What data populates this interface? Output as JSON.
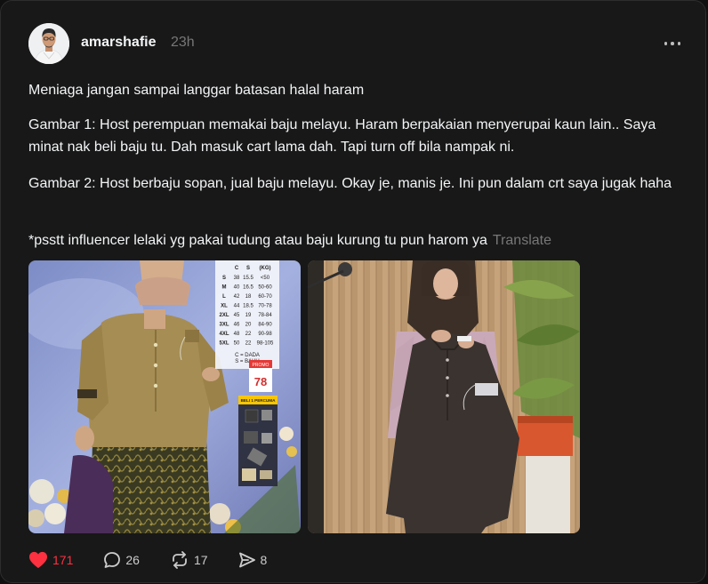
{
  "post": {
    "author": {
      "username": "amarshafie",
      "avatar_icon": "profile-avatar"
    },
    "timestamp": "23h",
    "paragraphs": [
      "Meniaga jangan sampai langgar batasan halal haram",
      "Gambar 1: Host perempuan memakai baju melayu. Haram berpakaian menyerupai kaun lain.. Saya minat nak beli baju tu. Dah masuk cart lama dah. Tapi turn off bila nampak ni.",
      "Gambar 2: Host berbaju sopan, jual baju melayu. Okay je, manis je. Ini pun dalam crt saya jugak haha",
      "*psstt influencer lelaki yg pakai tudung atau baju kurung tu pun harom ya"
    ],
    "translate_label": "Translate",
    "images": [
      {
        "size_chart": {
          "header": [
            "C",
            "S",
            "(KG)"
          ],
          "rows": [
            [
              "S",
              "38",
              "15.5",
              "<50"
            ],
            [
              "M",
              "40",
              "16.5",
              "50-60"
            ],
            [
              "L",
              "42",
              "18",
              "60-70"
            ],
            [
              "XL",
              "44",
              "18.5",
              "70-78"
            ],
            [
              "2XL",
              "45",
              "19",
              "78-84"
            ],
            [
              "3XL",
              "46",
              "20",
              "84-90"
            ],
            [
              "4XL",
              "48",
              "22",
              "90-98"
            ],
            [
              "5XL",
              "50",
              "22",
              "98-105"
            ]
          ],
          "legend": [
            "C = DADA",
            "S = BAHU"
          ]
        },
        "price": "78",
        "promo_label": "BELI 1 PERCUMA"
      },
      {}
    ],
    "stats": {
      "likes": "171",
      "replies": "26",
      "reposts": "17",
      "shares": "8"
    },
    "colors": {
      "liked": "#ff3040",
      "muted": "#777777",
      "background": "#181818"
    }
  }
}
